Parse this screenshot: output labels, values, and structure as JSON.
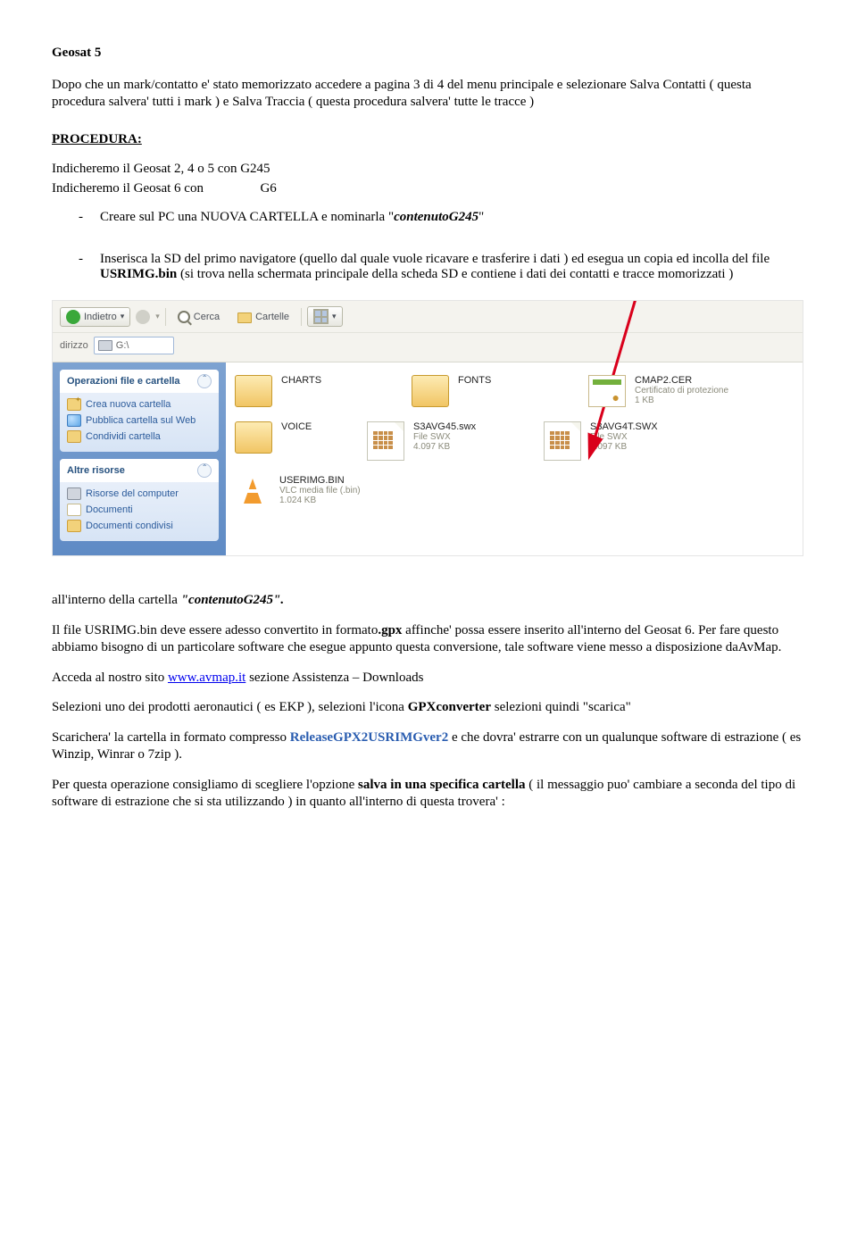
{
  "doc": {
    "title": "Geosat 5",
    "intro": "Dopo che un mark/contatto e' stato memorizzato accedere a pagina 3 di 4 del menu principale e selezionare Salva Contatti ( questa procedura salvera' tutti i mark ) e Salva Traccia ( questa procedura salvera' tutte le tracce )",
    "procedura_heading": "PROCEDURA:",
    "line1_a": "Indicheremo il Geosat 2, 4 o 5 con G245",
    "line1_b_pre": "Indicheremo il Geosat 6 con",
    "line1_b_val": "G6",
    "bullet1_pre": "Creare sul PC una NUOVA CARTELLA  e nominarla \"",
    "bullet1_em": "contenutoG245",
    "bullet1_post": "\"",
    "bullet2_a": "Inserisca la SD del primo navigatore (quello dal quale vuole ricavare e trasferire i dati ) ed esegua un copia ed incolla del file ",
    "bullet2_file": "USRIMG.bin",
    "bullet2_b": " (si trova nella schermata principale della scheda SD e contiene i dati dei contatti e tracce momorizzati )",
    "post_shot_a": "all'interno della cartella ",
    "post_shot_em": "\"contenutoG245\".",
    "p3_a": "Il file USRIMG.bin deve essere adesso convertito in formato",
    "p3_b": ".gpx",
    "p3_c": " affinche' possa essere inserito all'interno del Geosat 6. Per fare questo abbiamo bisogno di un particolare software che esegue appunto questa conversione, tale software viene messo a disposizione daAvMap.",
    "p4_a": "Acceda al nostro sito ",
    "p4_link": "www.avmap.it",
    "p4_b": " sezione Assistenza – Downloads",
    "p5_a": "Selezioni uno dei prodotti aeronautici ( es EKP ), selezioni l'icona ",
    "p5_b": "GPXconverter",
    "p5_c": "  selezioni quindi \"scarica\"",
    "p6_a": "Scarichera'  la cartella in formato compresso ",
    "p6_b": "ReleaseGPX2USRIMGver2",
    "p6_c": " e che dovra' estrarre con un qualunque software di estrazione ( es Winzip, Winrar o 7zip ).",
    "p7_a": "Per questa operazione consigliamo di scegliere l'opzione ",
    "p7_b": "salva in una specifica cartella",
    "p7_c": " ( il messaggio puo' cambiare a seconda del tipo di software di estrazione che si sta utilizzando ) in quanto all'interno di questa trovera' :"
  },
  "shot": {
    "toolbar": {
      "back": "Indietro",
      "search": "Cerca",
      "folders": "Cartelle"
    },
    "address": {
      "label": "dirizzo",
      "value": "G:\\"
    },
    "sidebar": {
      "panel1": "Operazioni file e cartella",
      "p1_items": {
        "a": "Crea nuova cartella",
        "b": "Pubblica cartella sul Web",
        "c": "Condividi cartella"
      },
      "panel2": "Altre risorse",
      "p2_items": {
        "a": "Risorse del computer",
        "b": "Documenti",
        "c": "Documenti condivisi"
      }
    },
    "files": {
      "charts": {
        "name": "CHARTS",
        "sub1": "",
        "sub2": ""
      },
      "fonts": {
        "name": "FONTS",
        "sub1": "",
        "sub2": ""
      },
      "cmap": {
        "name": "CMAP2.CER",
        "sub1": "Certificato di protezione",
        "sub2": "1 KB"
      },
      "voice": {
        "name": "VOICE",
        "sub1": "",
        "sub2": ""
      },
      "swx1": {
        "name": "S3AVG45.swx",
        "sub1": "File SWX",
        "sub2": "4.097 KB"
      },
      "swx2": {
        "name": "S3AVG4T.SWX",
        "sub1": "File SWX",
        "sub2": "4.097 KB"
      },
      "usr": {
        "name": "USERIMG.BIN",
        "sub1": "VLC media file (.bin)",
        "sub2": "1.024 KB"
      }
    }
  }
}
